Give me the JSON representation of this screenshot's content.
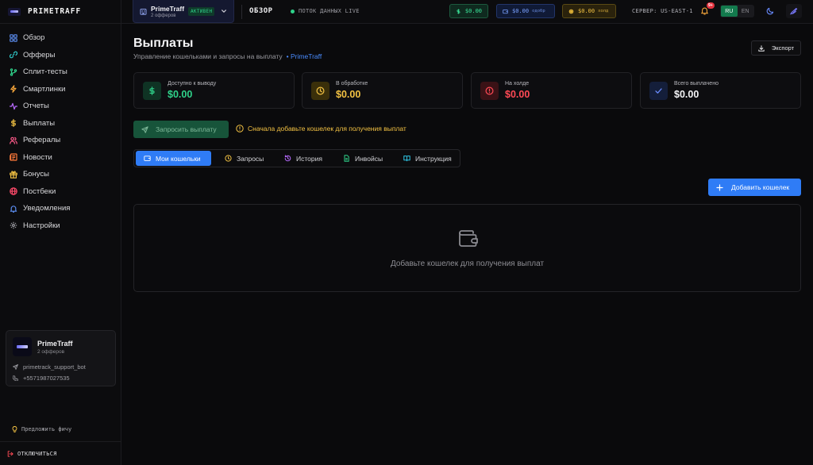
{
  "brand": {
    "name": "PRIMETRAFF"
  },
  "sidebar": {
    "items": [
      {
        "label": "Обзор",
        "icon": "grid-icon",
        "color": "#5b8def"
      },
      {
        "label": "Офферы",
        "icon": "link-icon",
        "color": "#2fc7c7"
      },
      {
        "label": "Сплит-тесты",
        "icon": "split-icon",
        "color": "#2fd28a"
      },
      {
        "label": "Смартлинки",
        "icon": "bolt-icon",
        "color": "#f3a43a"
      },
      {
        "label": "Отчеты",
        "icon": "activity-icon",
        "color": "#b86bff"
      },
      {
        "label": "Выплаты",
        "icon": "dollar-icon",
        "color": "#f3c243"
      },
      {
        "label": "Рефералы",
        "icon": "users-icon",
        "color": "#ff5a8a"
      },
      {
        "label": "Новости",
        "icon": "newspaper-icon",
        "color": "#ff7a3a"
      },
      {
        "label": "Бонусы",
        "icon": "gift-icon",
        "color": "#f3c243"
      },
      {
        "label": "Постбеки",
        "icon": "globe-icon",
        "color": "#ff4a6a"
      },
      {
        "label": "Уведомления",
        "icon": "bell-icon",
        "color": "#5b8def"
      },
      {
        "label": "Настройки",
        "icon": "gear-icon",
        "color": "#9a9aa0"
      }
    ],
    "card": {
      "name": "PrimeTraff",
      "sub": "2 офферов",
      "telegram": "primetrack_support_bot",
      "phone": "+5571987027535"
    },
    "suggest": "Предложить фичу",
    "logout": "ОТКЛЮЧИТЬСЯ"
  },
  "header": {
    "account": {
      "name": "PrimeTraff",
      "sub": "2 офферов",
      "badge": "АКТИВЕН"
    },
    "title": "ОБЗОР",
    "live": "ПОТОК ДАННЫХ LIVE",
    "balances": {
      "green": "$0.00",
      "blue": "$0.00",
      "blue_note": "одобр",
      "yellow": "$0.00",
      "yellow_note": "холд"
    },
    "server": "СЕРВЕР: US-EAST-1",
    "notif_badge": "9+",
    "lang_ru": "RU",
    "lang_en": "EN"
  },
  "main": {
    "title": "Выплаты",
    "subtitle": "Управление кошельками и запросы на выплату",
    "subtitle_link": "PrimeTraff",
    "export": "Экспорт",
    "stats": [
      {
        "label": "Доступно к выводу",
        "value": "$0.00"
      },
      {
        "label": "В обработке",
        "value": "$0.00"
      },
      {
        "label": "На холде",
        "value": "$0.00"
      },
      {
        "label": "Всего выплачено",
        "value": "$0.00"
      }
    ],
    "request_button": "Запросить выплату",
    "warning": "Сначала добавьте кошелек для получения выплат",
    "tabs": [
      "Мои кошельки",
      "Запросы",
      "История",
      "Инвойсы",
      "Инструкция"
    ],
    "add_wallet": "Добавить кошелек",
    "empty_text": "Добавьте кошелек для получения выплат"
  }
}
